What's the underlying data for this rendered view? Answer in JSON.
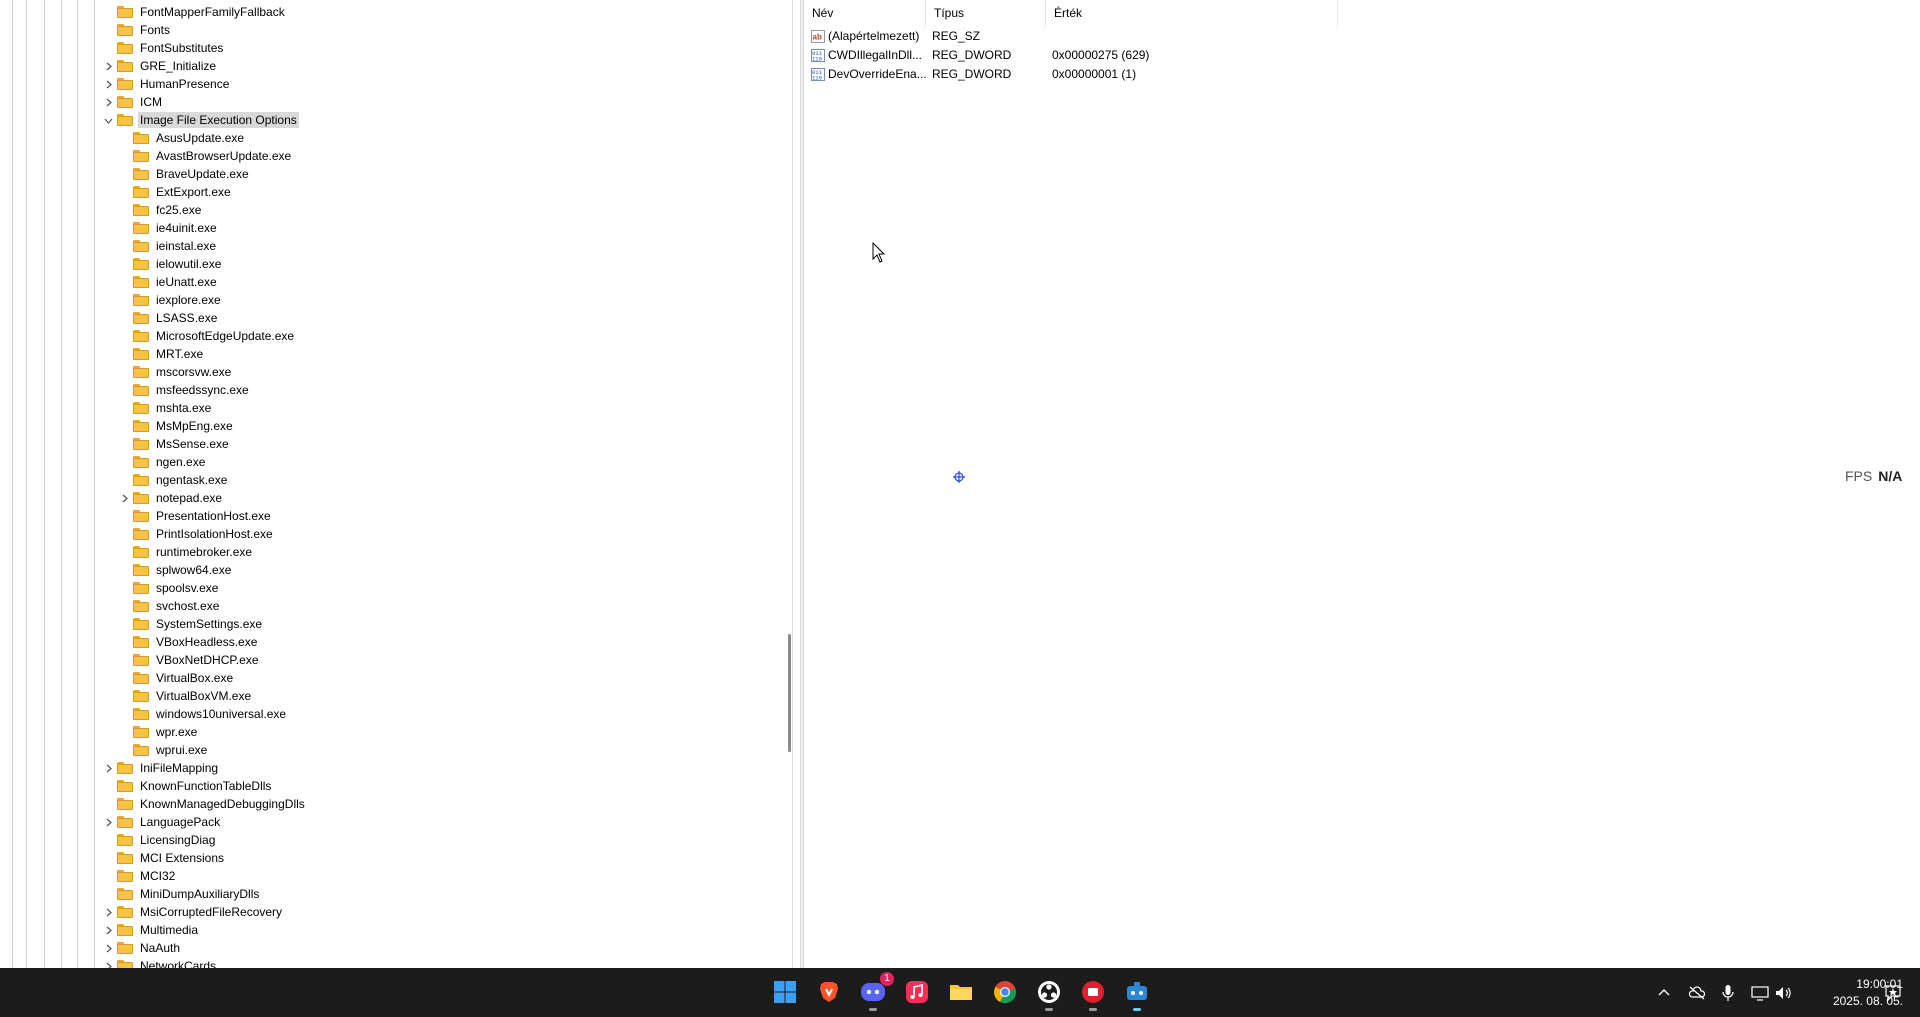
{
  "tree": {
    "rows": [
      {
        "label": "FontMapperFamilyFallback",
        "chevron": "none"
      },
      {
        "label": "Fonts",
        "chevron": "none"
      },
      {
        "label": "FontSubstitutes",
        "chevron": "none"
      },
      {
        "label": "GRE_Initialize",
        "chevron": "right"
      },
      {
        "label": "HumanPresence",
        "chevron": "right"
      },
      {
        "label": "ICM",
        "chevron": "right"
      },
      {
        "label": "Image File Execution Options",
        "chevron": "down",
        "selected": true
      },
      {
        "label": "AsusUpdate.exe",
        "chevron": "none",
        "child": true
      },
      {
        "label": "AvastBrowserUpdate.exe",
        "chevron": "none",
        "child": true
      },
      {
        "label": "BraveUpdate.exe",
        "chevron": "none",
        "child": true
      },
      {
        "label": "ExtExport.exe",
        "chevron": "none",
        "child": true
      },
      {
        "label": "fc25.exe",
        "chevron": "none",
        "child": true
      },
      {
        "label": "ie4uinit.exe",
        "chevron": "none",
        "child": true
      },
      {
        "label": "ieinstal.exe",
        "chevron": "none",
        "child": true
      },
      {
        "label": "ielowutil.exe",
        "chevron": "none",
        "child": true
      },
      {
        "label": "ieUnatt.exe",
        "chevron": "none",
        "child": true
      },
      {
        "label": "iexplore.exe",
        "chevron": "none",
        "child": true
      },
      {
        "label": "LSASS.exe",
        "chevron": "none",
        "child": true
      },
      {
        "label": "MicrosoftEdgeUpdate.exe",
        "chevron": "none",
        "child": true
      },
      {
        "label": "MRT.exe",
        "chevron": "none",
        "child": true
      },
      {
        "label": "mscorsvw.exe",
        "chevron": "none",
        "child": true
      },
      {
        "label": "msfeedssync.exe",
        "chevron": "none",
        "child": true
      },
      {
        "label": "mshta.exe",
        "chevron": "none",
        "child": true
      },
      {
        "label": "MsMpEng.exe",
        "chevron": "none",
        "child": true
      },
      {
        "label": "MsSense.exe",
        "chevron": "none",
        "child": true
      },
      {
        "label": "ngen.exe",
        "chevron": "none",
        "child": true
      },
      {
        "label": "ngentask.exe",
        "chevron": "none",
        "child": true
      },
      {
        "label": "notepad.exe",
        "chevron": "right",
        "child": true
      },
      {
        "label": "PresentationHost.exe",
        "chevron": "none",
        "child": true
      },
      {
        "label": "PrintIsolationHost.exe",
        "chevron": "none",
        "child": true
      },
      {
        "label": "runtimebroker.exe",
        "chevron": "none",
        "child": true
      },
      {
        "label": "splwow64.exe",
        "chevron": "none",
        "child": true
      },
      {
        "label": "spoolsv.exe",
        "chevron": "none",
        "child": true
      },
      {
        "label": "svchost.exe",
        "chevron": "none",
        "child": true
      },
      {
        "label": "SystemSettings.exe",
        "chevron": "none",
        "child": true
      },
      {
        "label": "VBoxHeadless.exe",
        "chevron": "none",
        "child": true
      },
      {
        "label": "VBoxNetDHCP.exe",
        "chevron": "none",
        "child": true
      },
      {
        "label": "VirtualBox.exe",
        "chevron": "none",
        "child": true
      },
      {
        "label": "VirtualBoxVM.exe",
        "chevron": "none",
        "child": true
      },
      {
        "label": "windows10universal.exe",
        "chevron": "none",
        "child": true
      },
      {
        "label": "wpr.exe",
        "chevron": "none",
        "child": true
      },
      {
        "label": "wprui.exe",
        "chevron": "none",
        "child": true
      },
      {
        "label": "IniFileMapping",
        "chevron": "right"
      },
      {
        "label": "KnownFunctionTableDlls",
        "chevron": "none"
      },
      {
        "label": "KnownManagedDebuggingDlls",
        "chevron": "none"
      },
      {
        "label": "LanguagePack",
        "chevron": "right"
      },
      {
        "label": "LicensingDiag",
        "chevron": "none"
      },
      {
        "label": "MCI Extensions",
        "chevron": "none"
      },
      {
        "label": "MCI32",
        "chevron": "none"
      },
      {
        "label": "MiniDumpAuxiliaryDlls",
        "chevron": "none"
      },
      {
        "label": "MsiCorruptedFileRecovery",
        "chevron": "right"
      },
      {
        "label": "Multimedia",
        "chevron": "right"
      },
      {
        "label": "NaAuth",
        "chevron": "right"
      },
      {
        "label": "NetworkCards",
        "chevron": "right"
      }
    ]
  },
  "values": {
    "columns": {
      "name": "Név",
      "type": "Típus",
      "data": "Érték"
    },
    "rows": [
      {
        "name": "(Alapértelmezett)",
        "type": "REG_SZ",
        "data": "",
        "icon": "string-value-icon"
      },
      {
        "name": "CWDIllegalInDll...",
        "type": "REG_DWORD",
        "data": "0x00000275 (629)",
        "icon": "binary-value-icon"
      },
      {
        "name": "DevOverrideEna...",
        "type": "REG_DWORD",
        "data": "0x00000001 (1)",
        "icon": "binary-value-icon"
      }
    ]
  },
  "overlay": {
    "fps_label": "FPS",
    "fps_value": "N/A"
  },
  "taskbar": {
    "apps": [
      "start-icon",
      "brave-icon",
      "discord-icon",
      "music-icon",
      "file-explorer-icon",
      "chrome-icon",
      "obs-icon",
      "app-red-icon",
      "app-blue-icon"
    ],
    "discord_badge": "1",
    "tray": [
      "chevron-up-icon",
      "cloud-off-icon",
      "microphone-icon",
      "network-icon",
      "volume-icon",
      "notification-icon"
    ],
    "time": "19:00:01",
    "date": "2025. 08. 05."
  },
  "colors": {
    "folder": "#f5c34a",
    "selection": "#d9d9d9",
    "taskbar": "#1c1c1c"
  }
}
